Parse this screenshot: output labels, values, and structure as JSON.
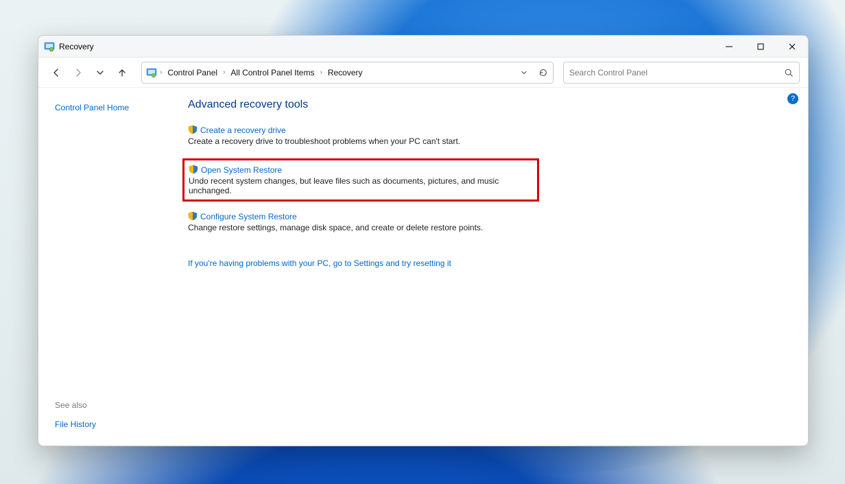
{
  "window": {
    "title": "Recovery"
  },
  "breadcrumb": {
    "items": [
      "Control Panel",
      "All Control Panel Items",
      "Recovery"
    ]
  },
  "search": {
    "placeholder": "Search Control Panel"
  },
  "sidebar": {
    "home_link": "Control Panel Home",
    "see_also_label": "See also",
    "file_history_link": "File History"
  },
  "content": {
    "heading": "Advanced recovery tools",
    "items": [
      {
        "link": "Create a recovery drive",
        "desc": "Create a recovery drive to troubleshoot problems when your PC can't start."
      },
      {
        "link": "Open System Restore",
        "desc": "Undo recent system changes, but leave files such as documents, pictures, and music unchanged.",
        "highlighted": true
      },
      {
        "link": "Configure System Restore",
        "desc": "Change restore settings, manage disk space, and create or delete restore points."
      }
    ],
    "footer_link": "If you're having problems with your PC, go to Settings and try resetting it"
  },
  "help_tooltip": "?"
}
